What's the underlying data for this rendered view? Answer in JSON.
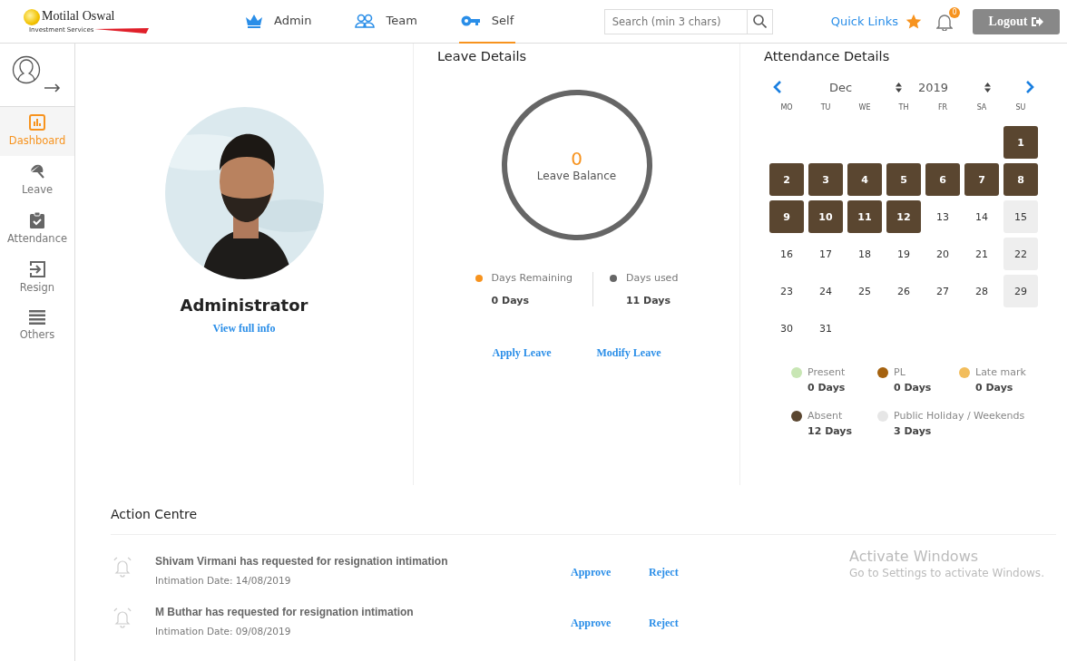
{
  "header": {
    "logo": {
      "name": "Motilal Oswal",
      "tagline": "Investment Services"
    },
    "nav": [
      {
        "label": "Admin",
        "selected": false
      },
      {
        "label": "Team",
        "selected": false
      },
      {
        "label": "Self",
        "selected": true
      }
    ],
    "search": {
      "placeholder": "Search (min 3 chars)"
    },
    "quick_links": "Quick Links",
    "notifications": "0",
    "logout": "Logout"
  },
  "sidebar": {
    "items": [
      {
        "label": "Dashboard",
        "selected": true
      },
      {
        "label": "Leave",
        "selected": false
      },
      {
        "label": "Attendance",
        "selected": false
      },
      {
        "label": "Resign",
        "selected": false
      },
      {
        "label": "Others",
        "selected": false
      }
    ]
  },
  "profile": {
    "name": "Administrator",
    "link": "View full info"
  },
  "leave_details": {
    "title": "Leave Details",
    "balance_value": "0",
    "balance_label": "Leave Balance",
    "ring": {
      "level": 1
    },
    "stats": [
      {
        "label": "Days Remaining",
        "value": "0 Days",
        "color": "#f7931e"
      },
      {
        "label": "Days used",
        "value": "11 Days",
        "color": "#666666"
      }
    ],
    "actions": [
      "Apply Leave",
      "Modify Leave"
    ]
  },
  "attendance": {
    "title": "Attendance Details",
    "month": "Dec",
    "year": "2019",
    "weekdays": [
      "MO",
      "TU",
      "WE",
      "TH",
      "FR",
      "SA",
      "SU"
    ],
    "weeks": [
      [
        {
          "day": "1",
          "kind": "absent"
        }
      ],
      [
        {
          "day": "2",
          "kind": "absent"
        },
        {
          "day": "3",
          "kind": "absent"
        },
        {
          "day": "4",
          "kind": "absent"
        },
        {
          "day": "5",
          "kind": "absent"
        },
        {
          "day": "6",
          "kind": "absent"
        },
        {
          "day": "7",
          "kind": "absent"
        },
        {
          "day": "8",
          "kind": "absent"
        }
      ],
      [
        {
          "day": "9",
          "kind": "absent"
        },
        {
          "day": "10",
          "kind": "absent"
        },
        {
          "day": "11",
          "kind": "absent"
        },
        {
          "day": "12",
          "kind": "absent"
        },
        {
          "day": "13",
          "kind": "plain"
        },
        {
          "day": "14",
          "kind": "plain"
        },
        {
          "day": "15",
          "kind": "holiday"
        }
      ],
      [
        {
          "day": "16",
          "kind": "plain"
        },
        {
          "day": "17",
          "kind": "plain"
        },
        {
          "day": "18",
          "kind": "plain"
        },
        {
          "day": "19",
          "kind": "plain"
        },
        {
          "day": "20",
          "kind": "plain"
        },
        {
          "day": "21",
          "kind": "plain"
        },
        {
          "day": "22",
          "kind": "holiday"
        }
      ],
      [
        {
          "day": "23",
          "kind": "plain"
        },
        {
          "day": "24",
          "kind": "plain"
        },
        {
          "day": "25",
          "kind": "plain"
        },
        {
          "day": "26",
          "kind": "plain"
        },
        {
          "day": "27",
          "kind": "plain"
        },
        {
          "day": "28",
          "kind": "plain"
        },
        {
          "day": "29",
          "kind": "holiday"
        }
      ],
      [
        {
          "day": "30",
          "kind": "plain"
        },
        {
          "day": "31",
          "kind": "plain"
        }
      ]
    ],
    "legend": [
      {
        "label": "Present",
        "value": "0 Days",
        "color": "#c8e6b4"
      },
      {
        "label": "PL",
        "value": "0 Days",
        "color": "#a5620f"
      },
      {
        "label": "Late mark",
        "value": "0 Days",
        "color": "#f2bd5c"
      },
      {
        "label": "Absent",
        "value": "12 Days",
        "color": "#5a4630"
      },
      {
        "label": "Public Holiday / Weekends",
        "value": "3 Days",
        "color": "#e6e6e6"
      }
    ]
  },
  "action_centre": {
    "title": "Action Centre",
    "items": [
      {
        "message": "Shivam Virmani has requested for resignation intimation",
        "date": "Intimation Date: 14/08/2019",
        "approve": "Approve",
        "reject": "Reject"
      },
      {
        "message": "M Buthar has requested for resignation intimation",
        "date": "Intimation Date: 09/08/2019",
        "approve": "Approve",
        "reject": "Reject"
      }
    ]
  },
  "os_notice": {
    "title": "Activate Windows",
    "text": "Go to Settings to activate Windows."
  }
}
